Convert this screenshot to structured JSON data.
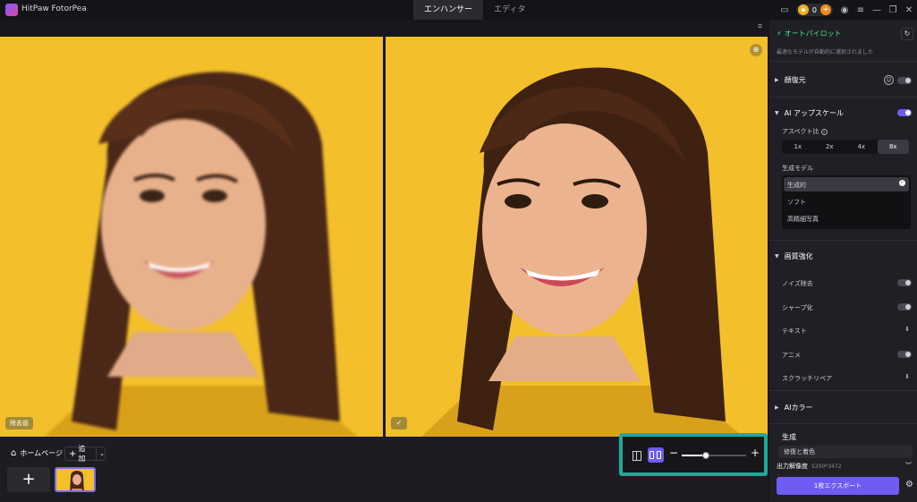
{
  "app": {
    "name": "HitPaw FotorPea"
  },
  "tabs": [
    {
      "label": "エンハンサー",
      "active": true
    },
    {
      "label": "エディタ",
      "active": false
    }
  ],
  "credits": {
    "count": "0"
  },
  "canvas": {
    "before_badge": "除去前",
    "after_badge": "✓"
  },
  "bottom": {
    "home_label": "ホームページ",
    "add_label": "追加",
    "new_label": "+"
  },
  "view": {
    "zoom_fraction": 0.38
  },
  "panel": {
    "autopilot": {
      "title": "オートパイロット",
      "subtitle": "最適なモデルが自動的に選択されました"
    },
    "face_restore": {
      "label": "顔復元",
      "enabled": false
    },
    "ai_upscale": {
      "label": "AI アップスケール",
      "enabled": true,
      "aspect_label": "アスペクト比",
      "scales": [
        "1x",
        "2x",
        "4x",
        "8x"
      ],
      "selected_scale": "8x",
      "model_label": "生成モデル",
      "models": [
        "生成的",
        "ソフト",
        "高精細写真"
      ],
      "selected_model": "生成的"
    },
    "quality": {
      "label": "画質強化",
      "options": [
        {
          "label": "ノイズ除去",
          "control": "toggle"
        },
        {
          "label": "シャープ化",
          "control": "toggle"
        },
        {
          "label": "テキスト",
          "control": "download"
        },
        {
          "label": "アニメ",
          "control": "toggle"
        },
        {
          "label": "スクラッチリペア",
          "control": "download"
        }
      ]
    },
    "ai_color": {
      "label": "AIカラー"
    },
    "generate": {
      "label": "生成",
      "item": "修復と着色"
    },
    "output": {
      "label": "出力解像度",
      "value": "5200*3472"
    },
    "export_label": "1枚エクスポート"
  },
  "colors": {
    "accent": "#6e5cf5",
    "highlight": "#1fa99a",
    "autopilot": "#4fe38a",
    "background": "#f3bf2b"
  }
}
